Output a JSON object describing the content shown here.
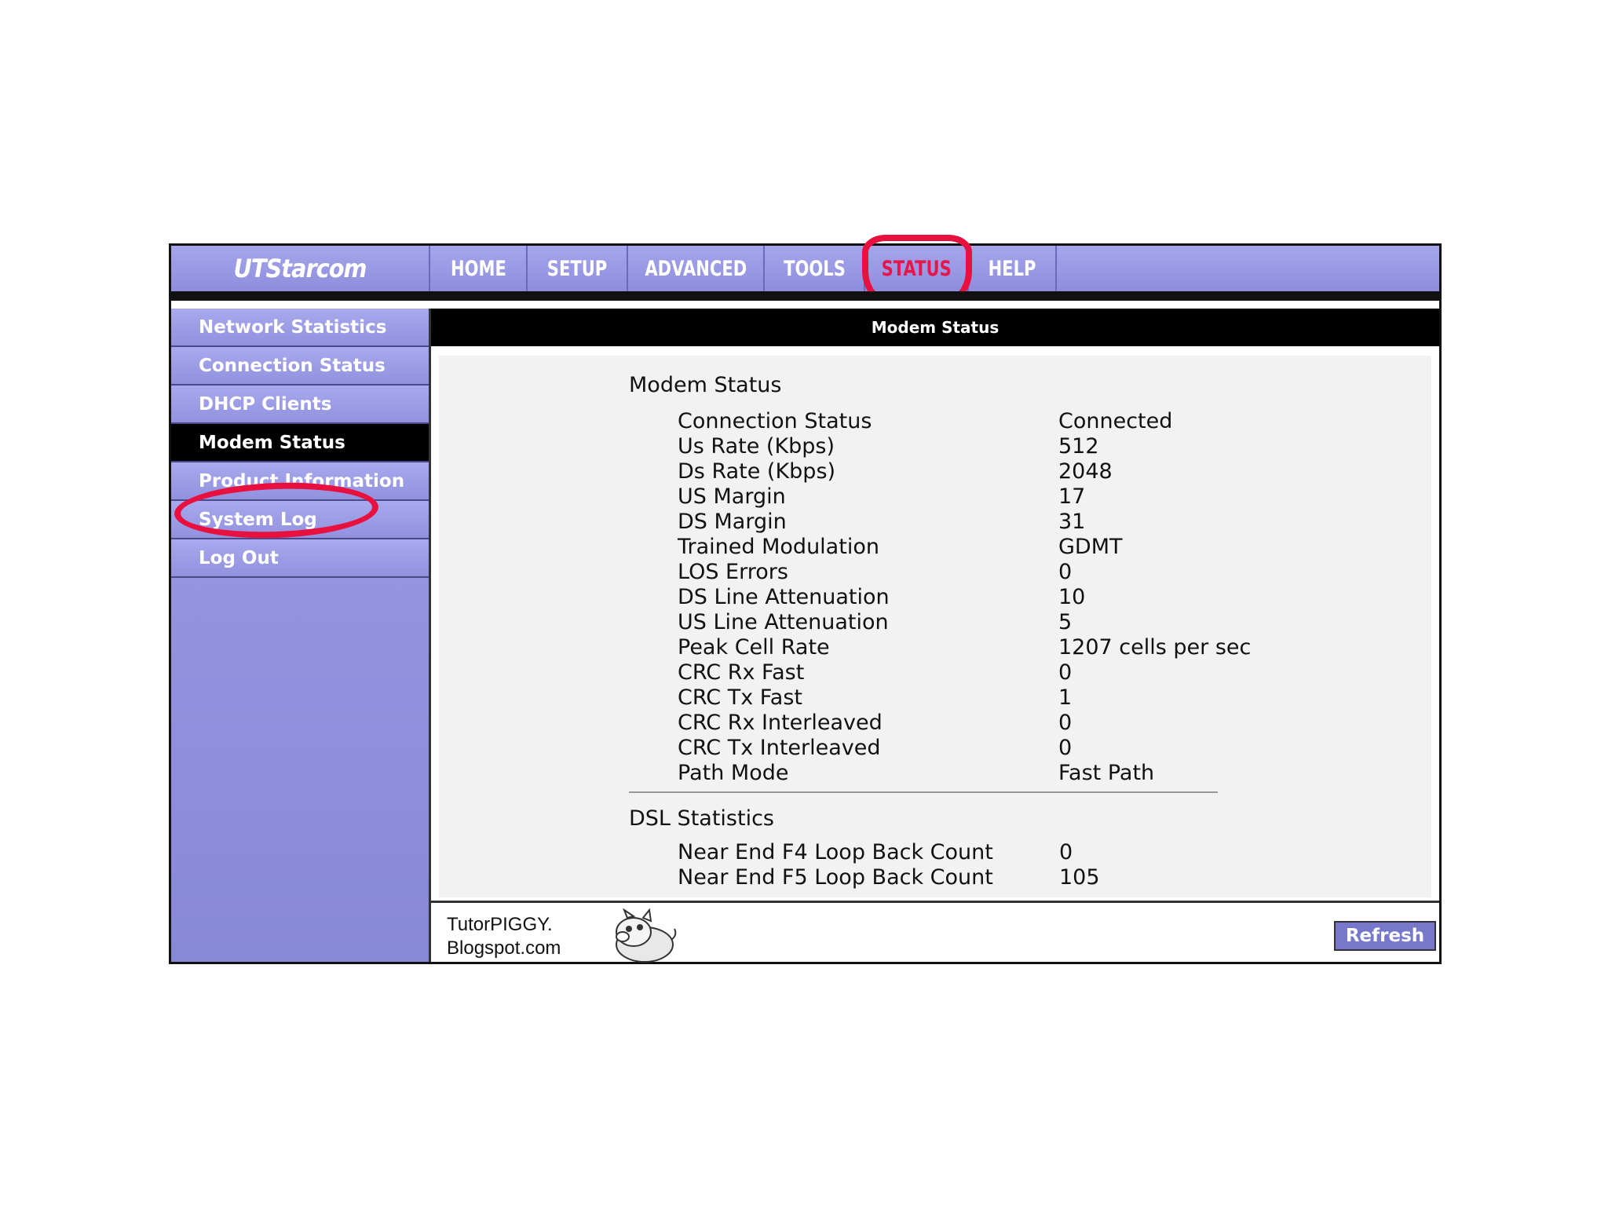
{
  "logo": "UTStarcom",
  "nav": {
    "tabs": [
      {
        "label": "HOME",
        "active": false
      },
      {
        "label": "SETUP",
        "active": false
      },
      {
        "label": "ADVANCED",
        "active": false
      },
      {
        "label": "TOOLS",
        "active": false
      },
      {
        "label": "STATUS",
        "active": true
      },
      {
        "label": "HELP",
        "active": false
      }
    ]
  },
  "sidebar": {
    "items": [
      {
        "label": "Network Statistics",
        "active": false
      },
      {
        "label": "Connection Status",
        "active": false
      },
      {
        "label": "DHCP Clients",
        "active": false
      },
      {
        "label": "Modem Status",
        "active": true
      },
      {
        "label": "Product Information",
        "active": false
      },
      {
        "label": "System Log",
        "active": false
      },
      {
        "label": "Log Out",
        "active": false
      }
    ]
  },
  "content": {
    "header": "Modem Status",
    "modem_section_title": "Modem Status",
    "modem_rows": [
      {
        "label": "Connection Status",
        "value": "Connected"
      },
      {
        "label": "Us Rate (Kbps)",
        "value": "512"
      },
      {
        "label": "Ds Rate (Kbps)",
        "value": "2048"
      },
      {
        "label": "US Margin",
        "value": "17"
      },
      {
        "label": "DS Margin",
        "value": "31"
      },
      {
        "label": "Trained Modulation",
        "value": "GDMT"
      },
      {
        "label": "LOS Errors",
        "value": "0"
      },
      {
        "label": "DS Line Attenuation",
        "value": "10"
      },
      {
        "label": "US Line Attenuation",
        "value": "5"
      },
      {
        "label": "Peak Cell Rate",
        "value": "1207 cells per sec"
      },
      {
        "label": "CRC Rx Fast",
        "value": "0"
      },
      {
        "label": "CRC Tx Fast",
        "value": "1"
      },
      {
        "label": "CRC Rx Interleaved",
        "value": "0"
      },
      {
        "label": "CRC Tx Interleaved",
        "value": "0"
      },
      {
        "label": "Path Mode",
        "value": "Fast Path"
      }
    ],
    "dsl_section_title": "DSL Statistics",
    "dsl_rows": [
      {
        "label": "Near End F4 Loop Back Count",
        "value": "0"
      },
      {
        "label": "Near End F5 Loop Back Count",
        "value": "105"
      }
    ],
    "refresh_label": "Refresh"
  },
  "watermark": {
    "line1": "TutorPIGGY.",
    "line2": "Blogspot.com"
  },
  "colors": {
    "nav_bg": "#9a9ae4",
    "annotation_red": "#e8103e",
    "active_bg": "#000000"
  }
}
